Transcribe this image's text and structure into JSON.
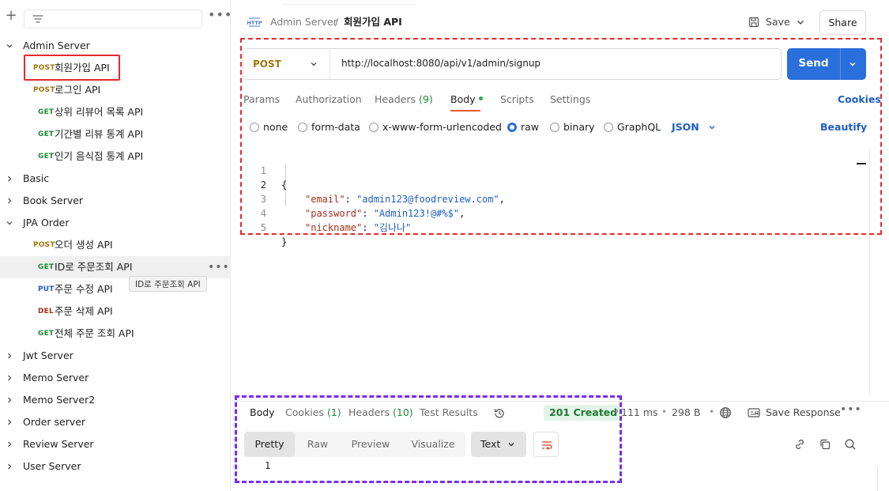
{
  "sidebar": {
    "items": [
      {
        "type": "folder",
        "name": "Admin Server",
        "expanded": true
      },
      {
        "type": "request",
        "method": "POST",
        "name": "회원가입 API"
      },
      {
        "type": "request",
        "method": "POST",
        "name": "로그인 API"
      },
      {
        "type": "request",
        "method": "GET",
        "name": "상위 리뷰어 목록 API"
      },
      {
        "type": "request",
        "method": "GET",
        "name": "기간별 리뷰 통계 API"
      },
      {
        "type": "request",
        "method": "GET",
        "name": "인기 음식점 통계 API"
      },
      {
        "type": "folder",
        "name": "Basic",
        "expanded": false
      },
      {
        "type": "folder",
        "name": "Book Server",
        "expanded": false
      },
      {
        "type": "folder",
        "name": "JPA Order",
        "expanded": true
      },
      {
        "type": "request",
        "method": "POST",
        "name": "오더 생성 API"
      },
      {
        "type": "request",
        "method": "GET",
        "name": "ID로 주문조회 API"
      },
      {
        "type": "request",
        "method": "PUT",
        "name": "주문 수정 API"
      },
      {
        "type": "request",
        "method": "DEL",
        "name": "주문 삭제 API"
      },
      {
        "type": "request",
        "method": "GET",
        "name": "전체 주문 조회 API"
      },
      {
        "type": "folder",
        "name": "Jwt Server",
        "expanded": false
      },
      {
        "type": "folder",
        "name": "Memo Server",
        "expanded": false
      },
      {
        "type": "folder",
        "name": "Memo Server2",
        "expanded": false
      },
      {
        "type": "folder",
        "name": "Order server",
        "expanded": false
      },
      {
        "type": "folder",
        "name": "Review Server",
        "expanded": false
      },
      {
        "type": "folder",
        "name": "User Server",
        "expanded": false
      }
    ],
    "tooltip": "ID로 주문조회 API"
  },
  "header": {
    "collection": "Admin Server",
    "separator": "/",
    "request_name": "회원가입 API",
    "save_label": "Save",
    "share_label": "Share"
  },
  "request": {
    "method": "POST",
    "url": "http://localhost:8080/api/v1/admin/signup",
    "send_label": "Send",
    "tabs": {
      "params": "Params",
      "authorization": "Authorization",
      "headers": "Headers",
      "headers_count": "(9)",
      "body": "Body",
      "scripts": "Scripts",
      "settings": "Settings"
    },
    "cookies_label": "Cookies",
    "body_types": {
      "none": "none",
      "form_data": "form-data",
      "urlencoded": "x-www-form-urlencoded",
      "raw": "raw",
      "binary": "binary",
      "graphql": "GraphQL"
    },
    "body_type_selected": "raw",
    "format": "JSON",
    "beautify_label": "Beautify",
    "body_lines": [
      "{",
      "\"email\": \"admin123@foodreview.com\",",
      "\"password\": \"Admin123!@#%$\",",
      "\"nickname\": \"김나나\"",
      "}"
    ],
    "email_key": "\"email\"",
    "email_value": "\"admin123@foodreview.com\"",
    "password_key": "\"password\"",
    "password_value": "\"Admin123!@#%$\"",
    "nickname_key": "\"nickname\"",
    "nickname_value": "\"김나나\"",
    "line_numbers": [
      "1",
      "2",
      "3",
      "4",
      "5"
    ]
  },
  "response": {
    "tabs": {
      "body": "Body",
      "cookies": "Cookies",
      "cookies_count": "(1)",
      "headers": "Headers",
      "headers_count": "(10)",
      "test_results": "Test Results"
    },
    "status": "201 Created",
    "time": "111 ms",
    "size": "298 B",
    "save_response_label": "Save Response",
    "views": {
      "pretty": "Pretty",
      "raw": "Raw",
      "preview": "Preview",
      "visualize": "Visualize"
    },
    "format": "Text",
    "line_1": "1"
  },
  "colors": {
    "post": "#a0750b",
    "get": "#208a3c",
    "put": "#1f5ec2",
    "del": "#a3301e",
    "send": "#2a6fdb",
    "annotation_red": "#e5292c",
    "annotation_purple": "#7a2cf0"
  }
}
